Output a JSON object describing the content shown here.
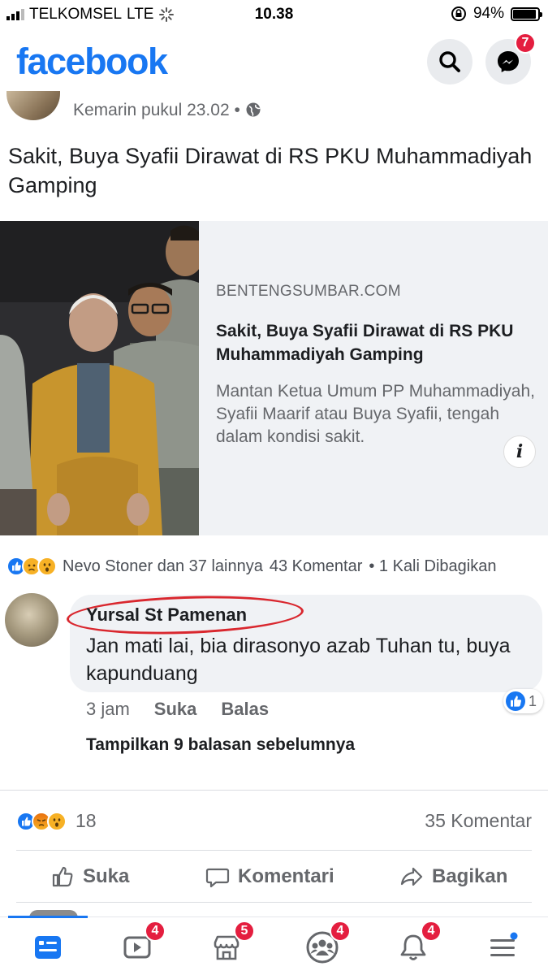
{
  "status_bar": {
    "carrier": "TELKOMSEL",
    "network": "LTE",
    "time": "10.38",
    "battery_percent": "94%",
    "battery_level": 0.94
  },
  "header": {
    "logo": "facebook",
    "icons": [
      "search-icon",
      "messenger-icon"
    ],
    "messenger_badge": "7"
  },
  "post": {
    "timestamp": "Kemarin pukul 23.02 •",
    "text": "Sakit, Buya Syafii Dirawat di RS PKU Muhammadiyah Gamping",
    "link_card": {
      "domain": "BENTENGSUMBAR.COM",
      "title": "Sakit, Buya Syafii Dirawat di RS PKU Muhammadiyah Gamping",
      "description": "Mantan Ketua Umum PP Muhammadiyah, Syafii Maarif atau Buya Syafii, tengah dalam kondisi sakit.",
      "info_icon": "i"
    },
    "shared_reactions": {
      "names": "Nevo Stoner dan 37 lainnya",
      "comments": "43 Komentar",
      "shares": "• 1 Kali Dibagikan"
    }
  },
  "comment": {
    "author": "Yursal St Pamenan",
    "text": "Jan mati lai, bia dirasonyo azab Tuhan tu, buya kapunduang",
    "time": "3 jam",
    "like_label": "Suka",
    "reply_label": "Balas",
    "like_count": "1",
    "previous_replies": "Tampilkan 9 balasan sebelumnya"
  },
  "summary": {
    "reaction_count": "18",
    "comment_count": "35 Komentar"
  },
  "actions": {
    "like": "Suka",
    "comment": "Komentari",
    "share": "Bagikan"
  },
  "bottom_nav": {
    "badges": {
      "watch": "4",
      "marketplace": "5",
      "groups": "4",
      "notifications": "4"
    }
  },
  "colors": {
    "brand": "#1877f2",
    "badge": "#e41e3f",
    "annotation_circle": "#d9272e"
  }
}
